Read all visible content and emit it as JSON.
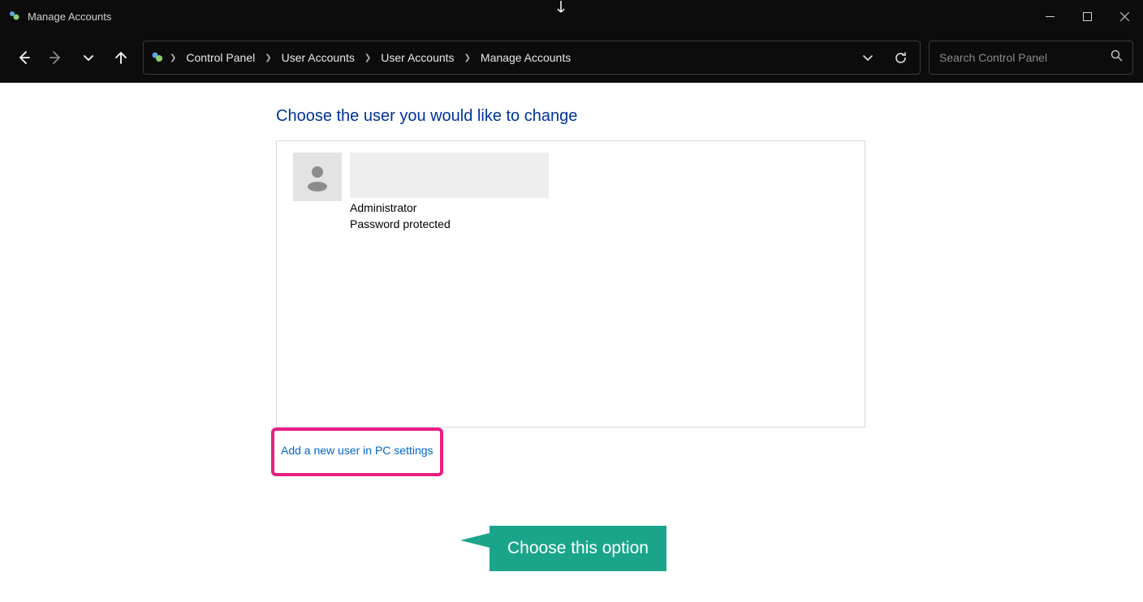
{
  "titlebar": {
    "title": "Manage Accounts"
  },
  "breadcrumb": {
    "items": [
      "Control Panel",
      "User Accounts",
      "User Accounts",
      "Manage Accounts"
    ]
  },
  "search": {
    "placeholder": "Search Control Panel"
  },
  "page": {
    "heading": "Choose the user you would like to change",
    "user": {
      "role": "Administrator",
      "status": "Password protected"
    },
    "add_link": "Add a new user in PC settings"
  },
  "annotation": {
    "callout": "Choose this option"
  }
}
